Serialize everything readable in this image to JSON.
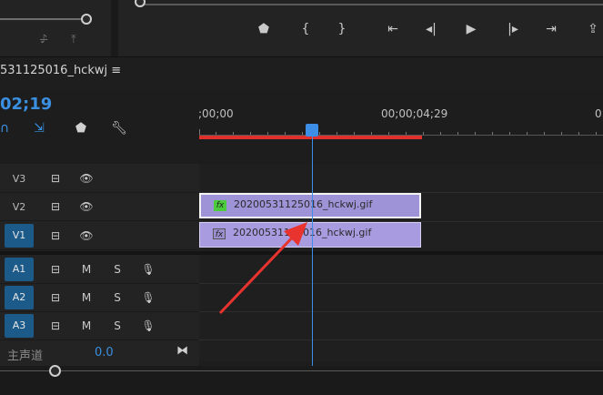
{
  "source_monitor": {
    "icons": [
      "audio-only-icon",
      "export-frame-icon"
    ]
  },
  "program_monitor": {
    "controls": [
      {
        "name": "add-marker-button",
        "glyph": "⬟"
      },
      {
        "name": "mark-in-button",
        "glyph": "{"
      },
      {
        "name": "mark-out-button",
        "glyph": "}"
      },
      {
        "name": "go-to-in-button",
        "glyph": "{←"
      },
      {
        "name": "step-back-button",
        "glyph": "◀|"
      },
      {
        "name": "play-button",
        "glyph": "▶"
      },
      {
        "name": "step-forward-button",
        "glyph": "|▶"
      },
      {
        "name": "go-to-out-button",
        "glyph": "→}"
      },
      {
        "name": "lift-button",
        "glyph": "⇪"
      }
    ]
  },
  "sequence": {
    "title": "531125016_hckwj ≡",
    "timecode": "02;19"
  },
  "ruler": {
    "labels": [
      ";00;00",
      "00;00;04;29",
      "0"
    ]
  },
  "tracks": [
    {
      "id": "V3",
      "targeted": false,
      "type": "video"
    },
    {
      "id": "V2",
      "targeted": false,
      "type": "video"
    },
    {
      "id": "V1",
      "targeted": true,
      "type": "video"
    },
    {
      "id": "A1",
      "targeted": true,
      "type": "audio",
      "mute": "M",
      "solo": "S"
    },
    {
      "id": "A2",
      "targeted": true,
      "type": "audio",
      "mute": "M",
      "solo": "S"
    },
    {
      "id": "A3",
      "targeted": true,
      "type": "audio",
      "mute": "M",
      "solo": "S"
    }
  ],
  "clips": [
    {
      "track": "V2",
      "name": "20200531125016_hckwj.gif",
      "fx": "fx",
      "selected": true
    },
    {
      "track": "V1",
      "name": "20200531125016_hckwj.gif",
      "fx": "fx",
      "selected": false
    }
  ],
  "master": {
    "label": "主声道",
    "value": "0.0"
  },
  "colors": {
    "accent": "#3c8ee6",
    "clip": "#a89be0",
    "work_area": "#e0302c",
    "annotation_arrow": "#e8332f"
  }
}
